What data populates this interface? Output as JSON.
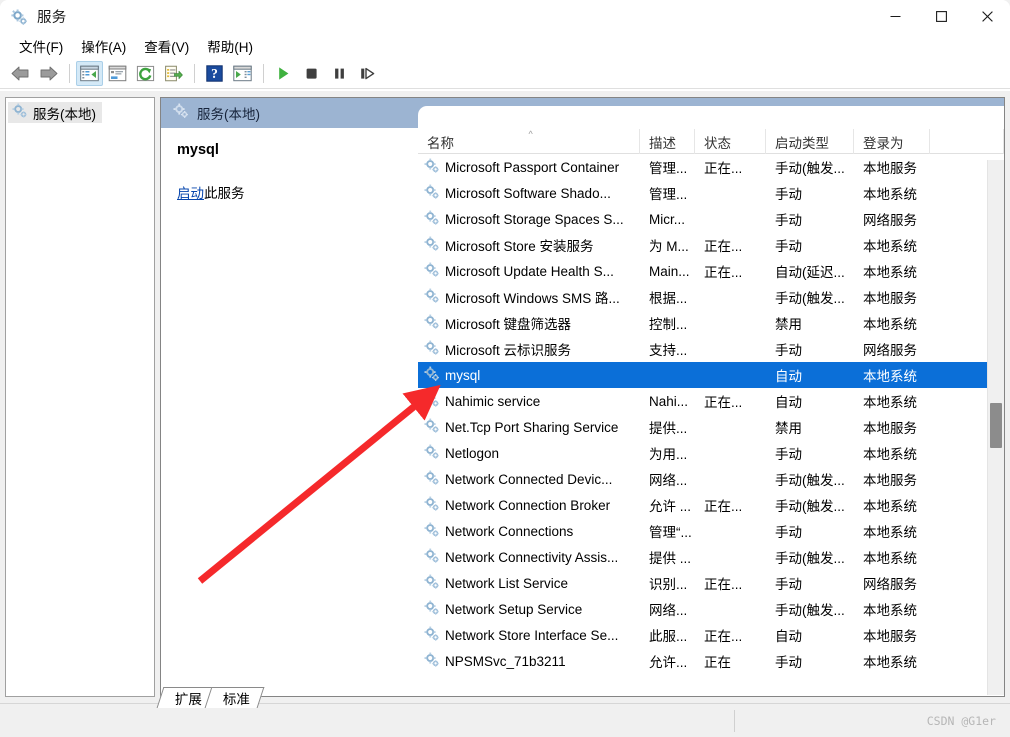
{
  "window": {
    "title": "服务",
    "icon": "services-gear-icon",
    "controls": {
      "minimize": "最小化",
      "maximize": "最大化",
      "close": "关闭"
    }
  },
  "menubar": {
    "items": [
      {
        "label": "文件(F)",
        "name": "menu-file"
      },
      {
        "label": "操作(A)",
        "name": "menu-action"
      },
      {
        "label": "查看(V)",
        "name": "menu-view"
      },
      {
        "label": "帮助(H)",
        "name": "menu-help"
      }
    ]
  },
  "toolbar": {
    "buttons": [
      {
        "name": "back-icon",
        "title": "后退"
      },
      {
        "name": "forward-icon",
        "title": "前进"
      },
      {
        "name": "show-hide-tree-icon",
        "title": "显示/隐藏控制台树",
        "active": true
      },
      {
        "name": "properties-icon",
        "title": "属性"
      },
      {
        "name": "refresh-icon",
        "title": "刷新"
      },
      {
        "name": "export-list-icon",
        "title": "导出列表"
      },
      {
        "name": "help-icon",
        "title": "帮助"
      },
      {
        "name": "show-action-pane-icon",
        "title": "显示/隐藏操作窗格"
      },
      {
        "name": "start-service-icon",
        "title": "启动服务"
      },
      {
        "name": "stop-service-icon",
        "title": "停止服务"
      },
      {
        "name": "pause-service-icon",
        "title": "暂停服务"
      },
      {
        "name": "restart-service-icon",
        "title": "重启服务"
      }
    ]
  },
  "tree": {
    "root": {
      "label": "服务(本地)",
      "icon": "services-gear-icon",
      "selected": true
    }
  },
  "pane": {
    "header": {
      "label": "服务(本地)",
      "icon": "services-gear-icon"
    },
    "detail": {
      "service_name": "mysql",
      "action_link": "启动",
      "action_rest": "此服务"
    }
  },
  "list": {
    "columns": [
      {
        "key": "name",
        "label": "名称",
        "sorted": true
      },
      {
        "key": "desc",
        "label": "描述"
      },
      {
        "key": "status",
        "label": "状态"
      },
      {
        "key": "start",
        "label": "启动类型"
      },
      {
        "key": "logon",
        "label": "登录为"
      }
    ],
    "rows": [
      {
        "name": "Microsoft Passport Container",
        "desc": "管理...",
        "status": "正在...",
        "start": "手动(触发...",
        "logon": "本地服务",
        "selected": false
      },
      {
        "name": "Microsoft Software Shado...",
        "desc": "管理...",
        "status": "",
        "start": "手动",
        "logon": "本地系统",
        "selected": false
      },
      {
        "name": "Microsoft Storage Spaces S...",
        "desc": "Micr...",
        "status": "",
        "start": "手动",
        "logon": "网络服务",
        "selected": false
      },
      {
        "name": "Microsoft Store 安装服务",
        "desc": "为 M...",
        "status": "正在...",
        "start": "手动",
        "logon": "本地系统",
        "selected": false
      },
      {
        "name": "Microsoft Update Health S...",
        "desc": "Main...",
        "status": "正在...",
        "start": "自动(延迟...",
        "logon": "本地系统",
        "selected": false
      },
      {
        "name": "Microsoft Windows SMS 路...",
        "desc": "根据...",
        "status": "",
        "start": "手动(触发...",
        "logon": "本地服务",
        "selected": false
      },
      {
        "name": "Microsoft 键盘筛选器",
        "desc": "控制...",
        "status": "",
        "start": "禁用",
        "logon": "本地系统",
        "selected": false
      },
      {
        "name": "Microsoft 云标识服务",
        "desc": "支持...",
        "status": "",
        "start": "手动",
        "logon": "网络服务",
        "selected": false
      },
      {
        "name": "mysql",
        "desc": "",
        "status": "",
        "start": "自动",
        "logon": "本地系统",
        "selected": true
      },
      {
        "name": "Nahimic service",
        "desc": "Nahi...",
        "status": "正在...",
        "start": "自动",
        "logon": "本地系统",
        "selected": false
      },
      {
        "name": "Net.Tcp Port Sharing Service",
        "desc": "提供...",
        "status": "",
        "start": "禁用",
        "logon": "本地服务",
        "selected": false
      },
      {
        "name": "Netlogon",
        "desc": "为用...",
        "status": "",
        "start": "手动",
        "logon": "本地系统",
        "selected": false
      },
      {
        "name": "Network Connected Devic...",
        "desc": "网络...",
        "status": "",
        "start": "手动(触发...",
        "logon": "本地服务",
        "selected": false
      },
      {
        "name": "Network Connection Broker",
        "desc": "允许 ...",
        "status": "正在...",
        "start": "手动(触发...",
        "logon": "本地系统",
        "selected": false
      },
      {
        "name": "Network Connections",
        "desc": "管理“...",
        "status": "",
        "start": "手动",
        "logon": "本地系统",
        "selected": false
      },
      {
        "name": "Network Connectivity Assis...",
        "desc": "提供 ...",
        "status": "",
        "start": "手动(触发...",
        "logon": "本地系统",
        "selected": false
      },
      {
        "name": "Network List Service",
        "desc": "识别...",
        "status": "正在...",
        "start": "手动",
        "logon": "网络服务",
        "selected": false
      },
      {
        "name": "Network Setup Service",
        "desc": "网络...",
        "status": "",
        "start": "手动(触发...",
        "logon": "本地系统",
        "selected": false
      },
      {
        "name": "Network Store Interface Se...",
        "desc": "此服...",
        "status": "正在...",
        "start": "自动",
        "logon": "本地服务",
        "selected": false
      },
      {
        "name": "NPSMSvc_71b3211",
        "desc": "允许...",
        "status": "正在",
        "start": "手动",
        "logon": "本地系统",
        "selected": false
      }
    ]
  },
  "tabs": [
    {
      "label": "扩展",
      "name": "tab-extended",
      "active": false
    },
    {
      "label": "标准",
      "name": "tab-standard",
      "active": true
    }
  ],
  "statusbar": {
    "watermark": "CSDN @G1er"
  },
  "colors": {
    "selection": "#0b6fd8",
    "pane_header": "#9cb4d2",
    "link": "#0645ad",
    "annotation": "#f5292b"
  }
}
